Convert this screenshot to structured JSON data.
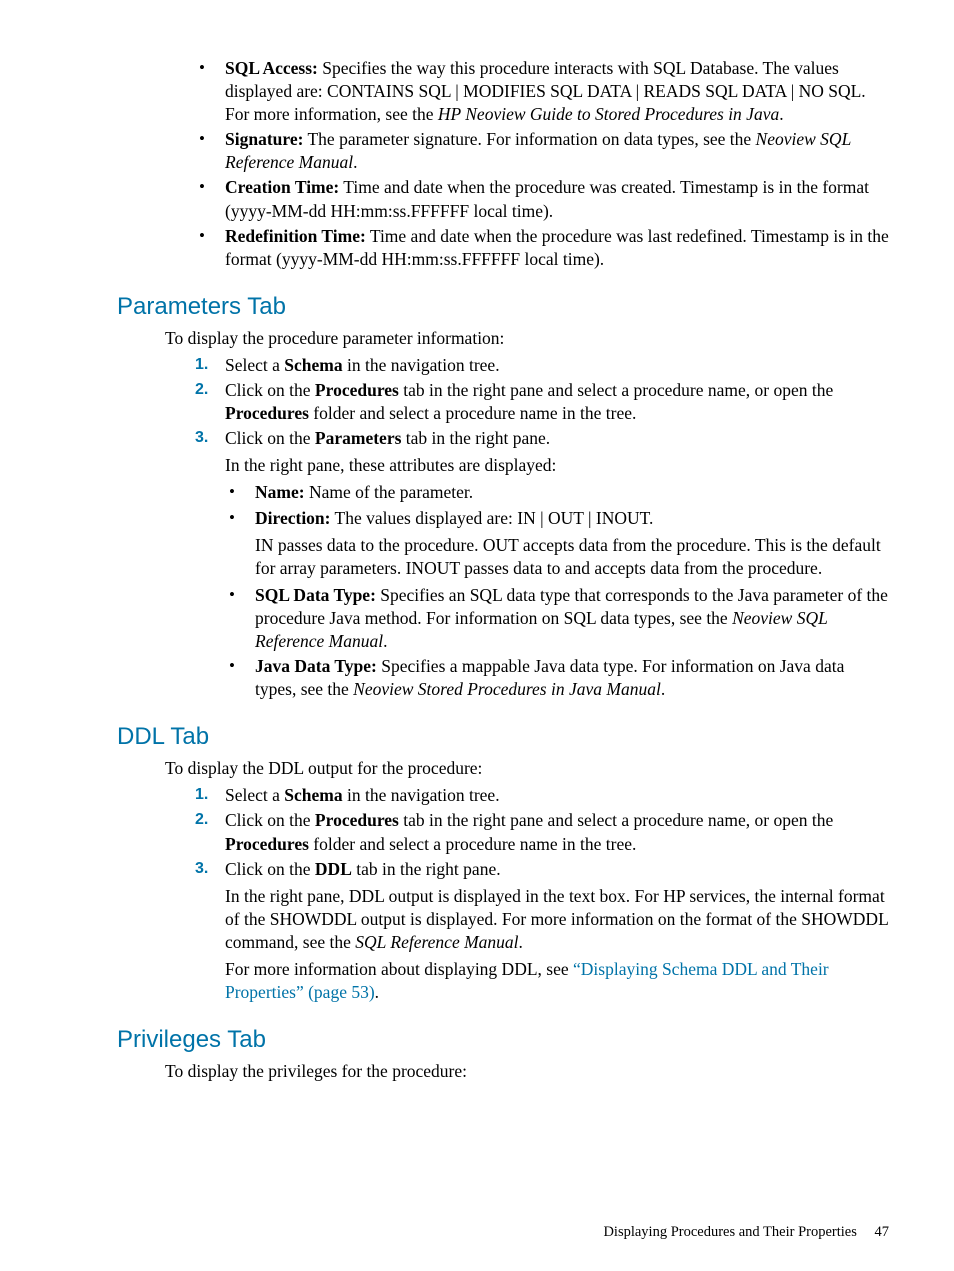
{
  "top_bullets": [
    {
      "bold": "SQL Access:",
      "rest": " Specifies the way this procedure interacts with SQL Database. The values displayed are: CONTAINS SQL | MODIFIES SQL DATA | READS SQL DATA | NO SQL. For more information, see the ",
      "ital": "HP Neoview Guide to Stored Procedures in Java",
      "tail": "."
    },
    {
      "bold": "Signature:",
      "rest": " The parameter signature. For information on data types, see the ",
      "ital": "Neoview SQL Reference Manual",
      "tail": "."
    },
    {
      "bold": "Creation Time:",
      "rest": " Time and date when the procedure was created. Timestamp is in the format (yyyy-MM-dd HH:mm:ss.FFFFFF local time)."
    },
    {
      "bold": "Redefinition Time:",
      "rest": " Time and date when the procedure was last redefined. Timestamp is in the format (yyyy-MM-dd HH:mm:ss.FFFFFF local time)."
    }
  ],
  "parameters": {
    "heading": "Parameters Tab",
    "intro": "To display the procedure parameter information:",
    "steps": [
      {
        "pre": "Select a ",
        "bold": "Schema",
        "post": "  in the navigation tree."
      },
      {
        "pre": "Click on the ",
        "bold": "Procedures",
        "post": " tab in the right pane and select a procedure name, or open the ",
        "bold2": "Procedures",
        "post2": " folder and select a procedure name in the tree."
      },
      {
        "pre": "Click on the ",
        "bold": "Parameters",
        "post": " tab in the right pane."
      }
    ],
    "after_step3": "In the right pane, these attributes are displayed:",
    "sub_bullets": [
      {
        "bold": "Name:",
        "rest": " Name of the parameter."
      },
      {
        "bold": "Direction:",
        "rest": " The values displayed are: IN | OUT | INOUT.",
        "extra": "IN passes data to the procedure. OUT accepts data from the procedure. This is the default for array parameters. INOUT passes data to and accepts data from the procedure."
      },
      {
        "bold": "SQL Data Type:",
        "rest": " Specifies an SQL data type that corresponds to the Java parameter of the procedure Java method. For information on SQL data types, see the ",
        "ital": "Neoview SQL Reference Manual",
        "tail": "."
      },
      {
        "bold": "Java Data Type:",
        "rest": " Specifies a mappable Java data type. For information on Java data types, see the ",
        "ital": "Neoview Stored Procedures in Java Manual",
        "tail": "."
      }
    ]
  },
  "ddl": {
    "heading": "DDL Tab",
    "intro": "To display the DDL output for the procedure:",
    "steps": [
      {
        "pre": "Select a ",
        "bold": "Schema",
        "post": " in the navigation tree."
      },
      {
        "pre": "Click on the ",
        "bold": "Procedures",
        "post": " tab in the right pane and select a procedure name, or open the ",
        "bold2": "Procedures",
        "post2": " folder and select a procedure name in the tree."
      },
      {
        "pre": "Click on the ",
        "bold": "DDL",
        "post": " tab in the right pane."
      }
    ],
    "body1_pre": "In the right pane, DDL output is displayed in the text box. For HP services, the internal format of the SHOWDDL output is displayed. For more information on the format of the SHOWDDL command, see the ",
    "body1_ital": "SQL Reference Manual",
    "body1_post": ".",
    "body2_pre": "For more information about displaying DDL, see ",
    "body2_link": "“Displaying Schema DDL and Their Properties” (page 53)",
    "body2_post": "."
  },
  "privileges": {
    "heading": "Privileges Tab",
    "intro": "To display the privileges for the procedure:"
  },
  "footer": {
    "title": "Displaying Procedures and Their Properties",
    "page": "47"
  }
}
